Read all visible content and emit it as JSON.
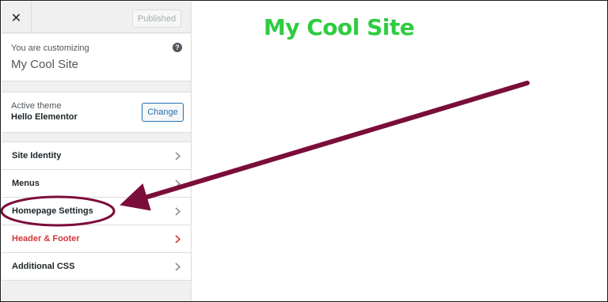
{
  "topbar": {
    "close_glyph": "✕",
    "publish_label": "Published"
  },
  "customizing": {
    "label": "You are customizing",
    "site_name": "My Cool Site",
    "help_glyph": "?"
  },
  "theme": {
    "label": "Active theme",
    "name": "Hello Elementor",
    "change_label": "Change"
  },
  "menu": {
    "items": [
      {
        "label": "Site Identity"
      },
      {
        "label": "Menus"
      },
      {
        "label": "Homepage Settings"
      },
      {
        "label": "Header & Footer"
      },
      {
        "label": "Additional CSS"
      }
    ]
  },
  "preview": {
    "site_title": "My Cool Site"
  },
  "colors": {
    "annotation": "#7b0d3a",
    "title_green": "#2ecc40",
    "highlight_red": "#d63638",
    "text_dark": "#1d2327",
    "chevron_gray": "#8c8f94"
  }
}
